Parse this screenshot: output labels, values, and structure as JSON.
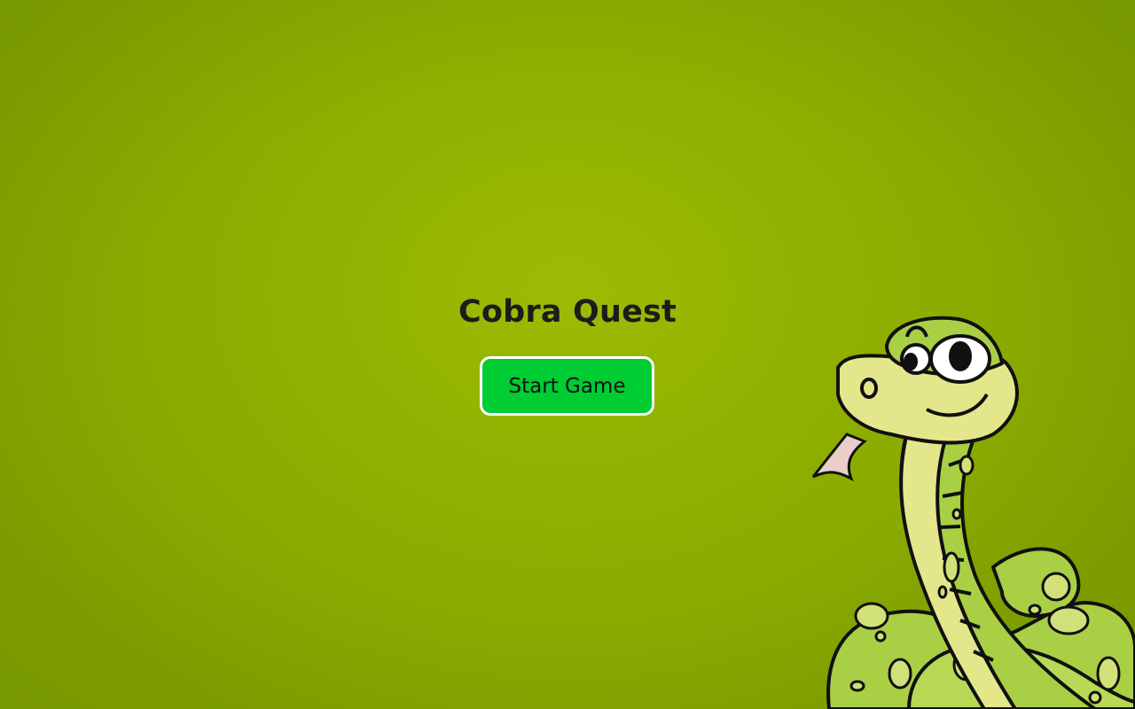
{
  "game": {
    "title": "Cobra Quest",
    "start_label": "Start Game"
  },
  "colors": {
    "background": "#8fb000",
    "button": "#00cc33",
    "button_border": "#ffffff",
    "title_text": "#1a1d1a",
    "snake_body": "#a9cf45",
    "snake_belly": "#e3e68a",
    "snake_spots": "#d2e07a",
    "snake_outline": "#101010"
  },
  "mascot": {
    "icon": "cartoon-snake-icon"
  }
}
